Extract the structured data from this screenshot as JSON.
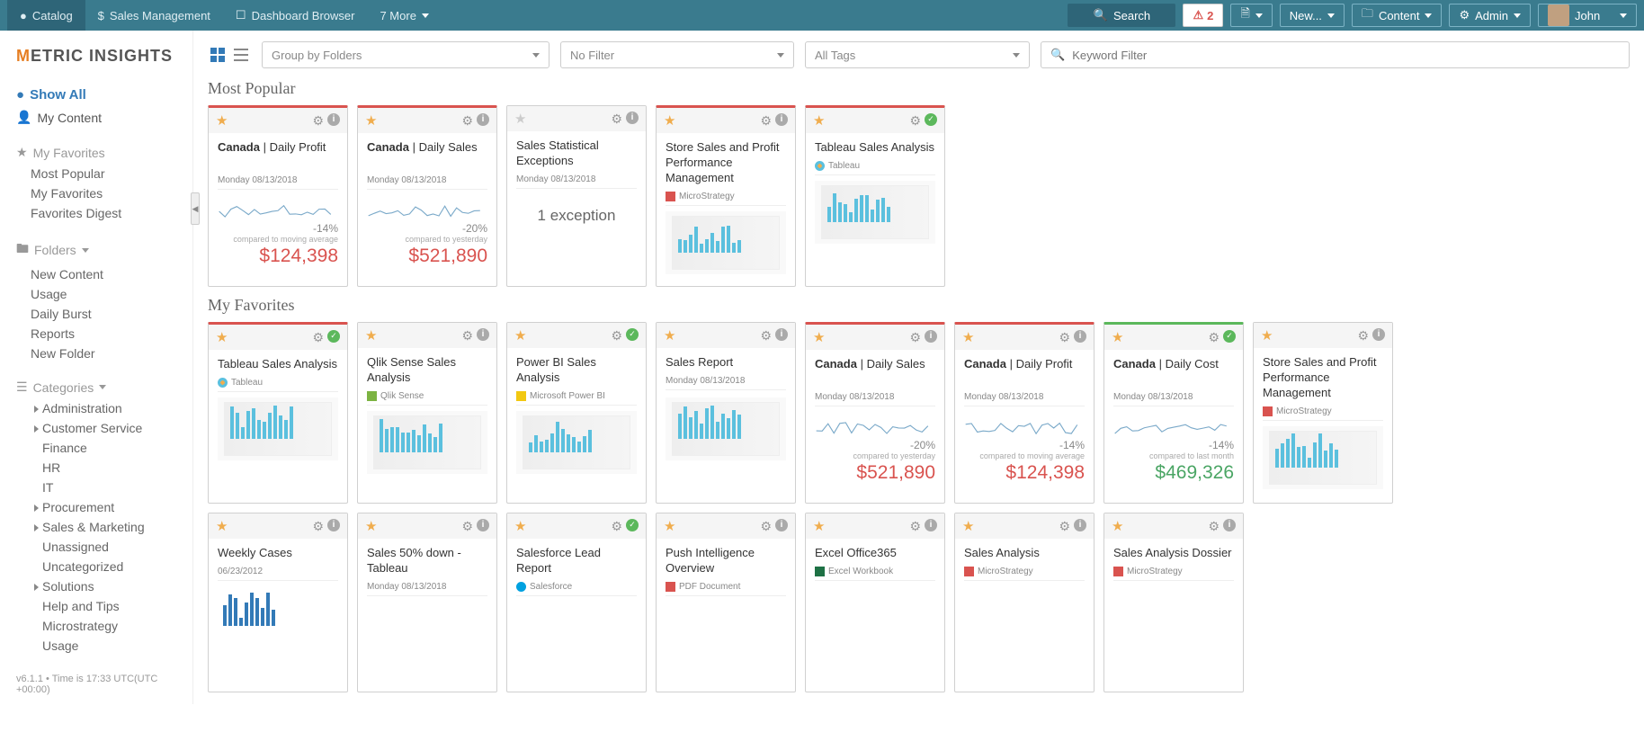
{
  "topnav": {
    "items": [
      {
        "label": "Catalog",
        "active": true,
        "icon": "circle"
      },
      {
        "label": "Sales Management",
        "active": false,
        "icon": "dollar"
      },
      {
        "label": "Dashboard Browser",
        "active": false,
        "icon": "window"
      },
      {
        "label": "7 More",
        "active": false,
        "icon": "caret"
      }
    ],
    "search": "Search",
    "alerts": "2",
    "new": "New...",
    "content": "Content",
    "admin": "Admin",
    "user": "John"
  },
  "logo_text": "METRIC INSIGHTS",
  "sidebar": {
    "show_all": "Show All",
    "my_content": "My Content",
    "favorites_header": "My Favorites",
    "fav_items": [
      "Most Popular",
      "My Favorites",
      "Favorites Digest"
    ],
    "folders_header": "Folders",
    "folder_items": [
      "New Content",
      "Usage",
      "Daily Burst",
      "Reports",
      "New Folder"
    ],
    "categories_header": "Categories",
    "cat_items": [
      {
        "label": "Administration",
        "expand": true
      },
      {
        "label": "Customer Service",
        "expand": true
      },
      {
        "label": "Finance",
        "expand": false
      },
      {
        "label": "HR",
        "expand": false
      },
      {
        "label": "IT",
        "expand": false
      },
      {
        "label": "Procurement",
        "expand": true
      },
      {
        "label": "Sales & Marketing",
        "expand": true
      },
      {
        "label": "Unassigned",
        "expand": false
      },
      {
        "label": "Uncategorized",
        "expand": false
      },
      {
        "label": "Solutions",
        "expand": true
      },
      {
        "label": "Help and Tips",
        "expand": false
      },
      {
        "label": "Microstrategy",
        "expand": false
      },
      {
        "label": "Usage",
        "expand": false
      }
    ]
  },
  "toolbar": {
    "group": "Group by Folders",
    "filter": "No Filter",
    "tags": "All Tags",
    "keyword": "Keyword Filter"
  },
  "sections": {
    "popular": "Most Popular",
    "favorites": "My Favorites"
  },
  "popular_cards": [
    {
      "title_bold": "Canada",
      "title_rest": " | Daily Profit",
      "date": "Monday 08/13/2018",
      "pct": "-14%",
      "compared": "compared to moving average",
      "value": "$124,398",
      "stripe": "red",
      "star": true,
      "check": false
    },
    {
      "title_bold": "Canada",
      "title_rest": " | Daily Sales",
      "date": "Monday 08/13/2018",
      "pct": "-20%",
      "compared": "compared to yesterday",
      "value": "$521,890",
      "stripe": "red",
      "star": true,
      "check": false
    },
    {
      "title_plain": "Sales Statistical Exceptions",
      "date": "Monday 08/13/2018",
      "exception": "1 exception",
      "stripe": "",
      "star": false,
      "check": false
    },
    {
      "title_plain": "Store Sales and Profit Performance Management",
      "source": "MicroStrategy",
      "source_icon": "ms",
      "stripe": "red",
      "star": true,
      "check": false,
      "thumb": true
    },
    {
      "title_plain": "Tableau Sales Analysis",
      "source": "Tableau",
      "source_icon": "tb",
      "stripe": "red",
      "star": true,
      "check": true,
      "thumb": true
    }
  ],
  "fav_cards": [
    {
      "title_plain": "Tableau Sales Analysis",
      "source": "Tableau",
      "source_icon": "tb",
      "stripe": "red",
      "star": true,
      "check": true,
      "thumb": true
    },
    {
      "title_plain": "Qlik Sense Sales Analysis",
      "source": "Qlik Sense",
      "source_icon": "qs",
      "stripe": "",
      "star": true,
      "check": false,
      "thumb": true
    },
    {
      "title_plain": "Power BI Sales Analysis",
      "source": "Microsoft Power BI",
      "source_icon": "pbi",
      "stripe": "",
      "star": true,
      "check": true,
      "thumb": true
    },
    {
      "title_plain": "Sales Report",
      "date": "Monday 08/13/2018",
      "stripe": "",
      "star": true,
      "check": false,
      "thumb": true
    },
    {
      "title_bold": "Canada",
      "title_rest": " | Daily Sales",
      "date": "Monday 08/13/2018",
      "pct": "-20%",
      "compared": "compared to yesterday",
      "value": "$521,890",
      "stripe": "red",
      "star": true,
      "check": false
    },
    {
      "title_bold": "Canada",
      "title_rest": " | Daily Profit",
      "date": "Monday 08/13/2018",
      "pct": "-14%",
      "compared": "compared to moving average",
      "value": "$124,398",
      "stripe": "red",
      "star": true,
      "check": false
    },
    {
      "title_bold": "Canada",
      "title_rest": " | Daily Cost",
      "date": "Monday 08/13/2018",
      "pct": "-14%",
      "compared": "compared to last month",
      "value": "$469,326",
      "value_color": "green",
      "stripe": "green",
      "star": true,
      "check": true
    },
    {
      "title_plain": "Store Sales and Profit Performance Management",
      "source": "MicroStrategy",
      "source_icon": "ms",
      "stripe": "",
      "star": true,
      "check": false,
      "thumb": true
    }
  ],
  "fav_cards2": [
    {
      "title_plain": "Weekly Cases",
      "date": "06/23/2012",
      "stripe": "",
      "star": true,
      "check": false,
      "bars": true
    },
    {
      "title_plain": "Sales 50% down - Tableau",
      "date": "Monday 08/13/2018",
      "stripe": "",
      "star": true,
      "check": false
    },
    {
      "title_plain": "Salesforce Lead Report",
      "source": "Salesforce",
      "source_icon": "sf",
      "stripe": "",
      "star": true,
      "check": true
    },
    {
      "title_plain": "Push Intelligence Overview",
      "source": "PDF Document",
      "source_icon": "pdf",
      "stripe": "",
      "star": true,
      "check": false
    },
    {
      "title_plain": "Excel Office365",
      "source": "Excel Workbook",
      "source_icon": "xl",
      "stripe": "",
      "star": true,
      "check": false
    },
    {
      "title_plain": "Sales Analysis",
      "source": "MicroStrategy",
      "source_icon": "ms",
      "stripe": "",
      "star": true,
      "check": false
    },
    {
      "title_plain": "Sales Analysis Dossier",
      "source": "MicroStrategy",
      "source_icon": "ms",
      "stripe": "",
      "star": true,
      "check": false
    }
  ],
  "footer": "v6.1.1 • Time is 17:33 UTC(UTC +00:00)"
}
